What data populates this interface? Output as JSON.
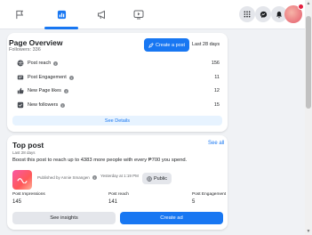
{
  "nav": {
    "tabs": [
      {
        "icon": "flag-icon"
      },
      {
        "icon": "insights-icon"
      },
      {
        "icon": "megaphone-icon"
      },
      {
        "icon": "video-icon"
      }
    ],
    "right": [
      "menu-grid-icon",
      "messenger-icon",
      "bell-icon",
      "profile-avatar"
    ]
  },
  "overview": {
    "title": "Page Overview",
    "followers": "Followers: 336",
    "create_post": "Create a post",
    "period": "Last 28 days",
    "metrics": [
      {
        "label": "Post reach",
        "value": "156"
      },
      {
        "label": "Post Engagement",
        "value": "11"
      },
      {
        "label": "New Page likes",
        "value": "12"
      },
      {
        "label": "New followers",
        "value": "15"
      }
    ],
    "see_details": "See Details"
  },
  "top_post": {
    "title": "Top post",
    "see_all": "See all",
    "period": "Last 28 days",
    "description": "Boost this post to reach up to 4383 more people with every ₱700 you spend.",
    "published_by": "Published by Annie Smangen",
    "time": "Yesterday at 1:19 PM",
    "audience": "Public",
    "stats": [
      {
        "label": "Post Impressions",
        "value": "145"
      },
      {
        "label": "Post reach",
        "value": "141"
      },
      {
        "label": "Post Engagement",
        "value": "5"
      }
    ],
    "see_insights": "See insights",
    "create_ad": "Create ad"
  },
  "colors": {
    "accent": "#1877f2",
    "background": "#f0f2f5"
  }
}
